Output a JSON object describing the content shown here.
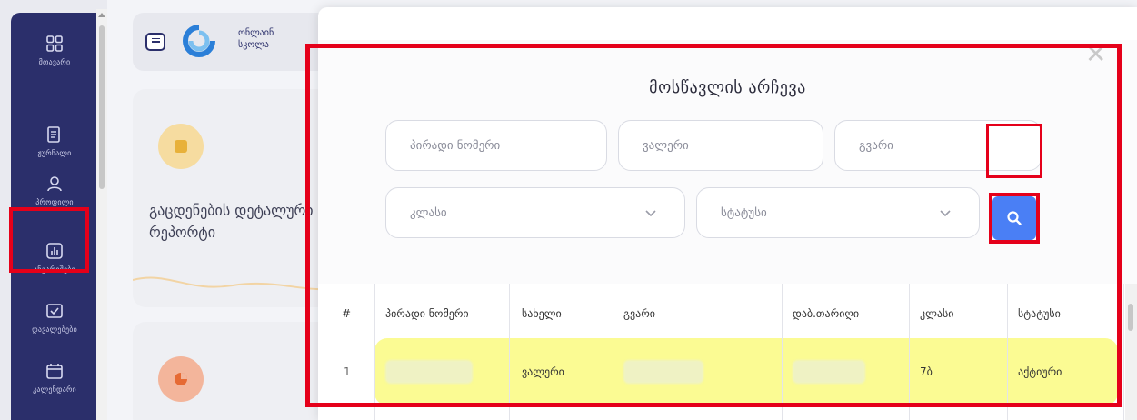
{
  "sidebar": {
    "items": [
      {
        "label": "მთავარი",
        "icon": "dashboard-icon"
      },
      {
        "label": "ჟურნალი",
        "icon": "journal-icon"
      },
      {
        "label": "პროფილი",
        "icon": "user-icon"
      },
      {
        "label": "ანგარიშები",
        "icon": "reports-icon"
      },
      {
        "label": "დავალებები",
        "icon": "tasks-icon"
      },
      {
        "label": "კალენდარი",
        "icon": "calendar-icon"
      }
    ]
  },
  "header": {
    "logo_line1": "ონლაინ",
    "logo_line2": "სკოლა"
  },
  "cards": {
    "report_title": "გაცდენების დეტალური რეპორტი"
  },
  "modal": {
    "title": "მოსწავლის არჩევა",
    "fields": {
      "personal_no_placeholder": "პირადი ნომერი",
      "first_name_placeholder": "ვალერი",
      "last_name_placeholder": "გვარი",
      "class_placeholder": "კლასი",
      "status_placeholder": "სტატუსი"
    }
  },
  "table": {
    "headers": [
      "#",
      "პირადი ნომერი",
      "სახელი",
      "გვარი",
      "დაბ.თარიღი",
      "კლასი",
      "სტატუსი"
    ],
    "rows": [
      {
        "num": "1",
        "personal_no": "",
        "first_name": "ვალერი",
        "last_name": "",
        "birth_date": "",
        "class": "7ბ",
        "status": "აქტიური"
      }
    ]
  },
  "colors": {
    "sidebar": "#2b2f6b",
    "search_button": "#4a7ff5",
    "highlight_row": "#fbfb93",
    "annotation_red": "#e5001a"
  }
}
